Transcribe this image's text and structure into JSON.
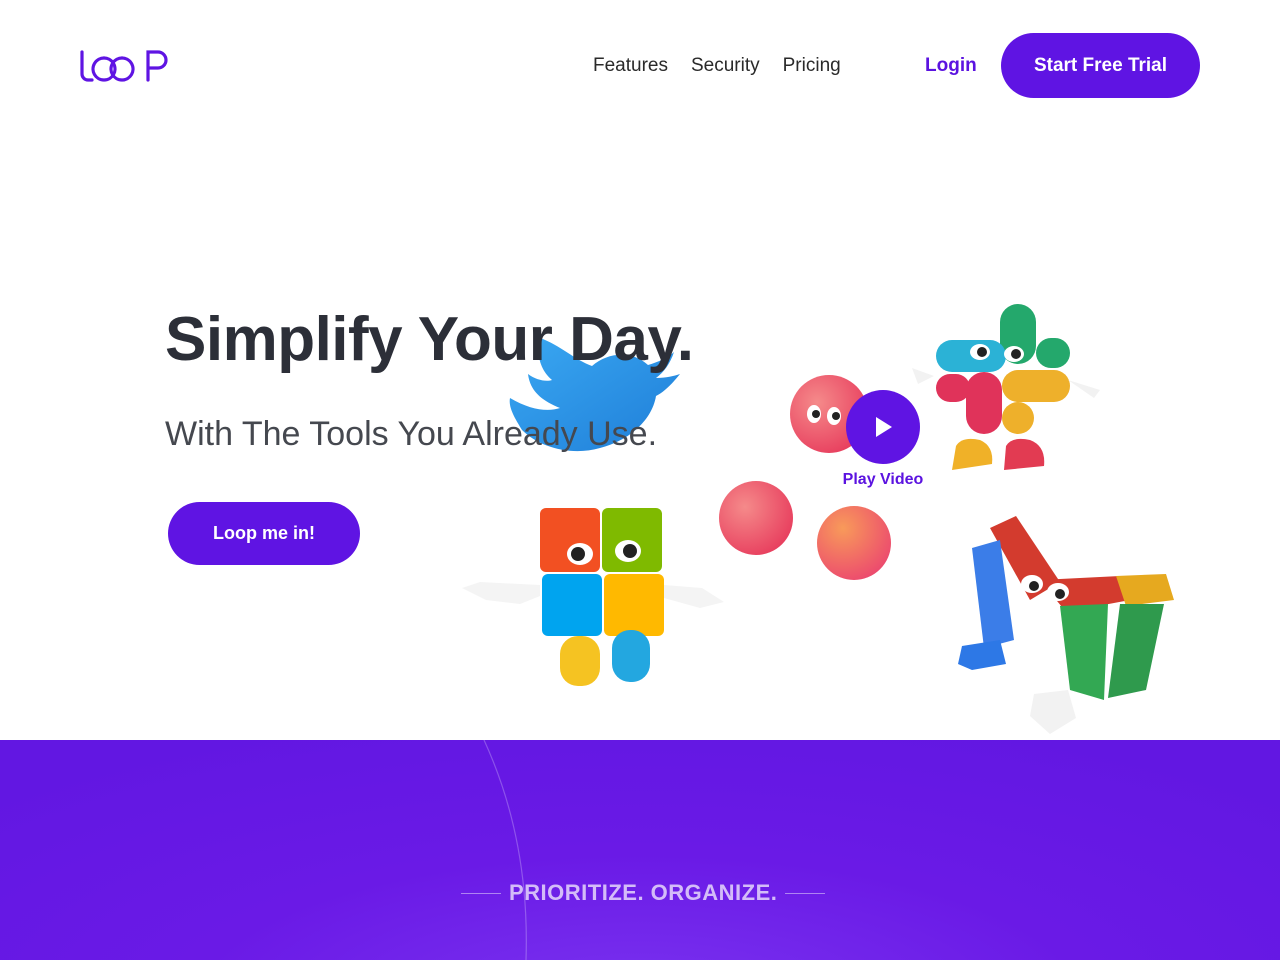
{
  "brand": {
    "logo_text": "LOOP",
    "accent": "#5f14e3"
  },
  "nav": {
    "items": [
      {
        "label": "Features"
      },
      {
        "label": "Security"
      },
      {
        "label": "Pricing"
      }
    ],
    "login_label": "Login",
    "trial_label": "Start Free Trial"
  },
  "hero": {
    "title": "Simplify Your Day.",
    "subtitle": "With The Tools You Already Use.",
    "cta_label": "Loop me in!",
    "play_label": "Play Video"
  },
  "illustrations": {
    "icons": [
      "twitter-bird-icon",
      "slack-character-icon",
      "microsoft-character-icon",
      "gmail-character-icon",
      "ball-icon",
      "play-icon"
    ]
  },
  "band": {
    "tagline": "PRIORITIZE. ORGANIZE.",
    "background": "#6217e2"
  }
}
